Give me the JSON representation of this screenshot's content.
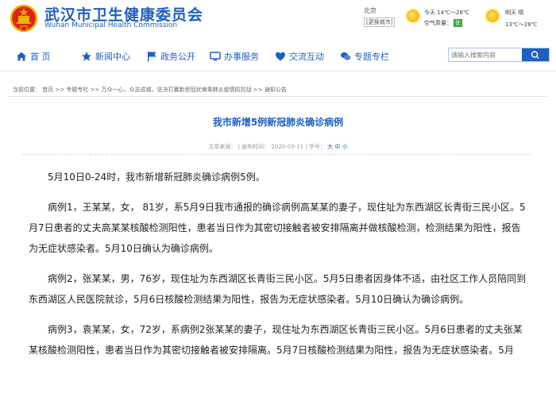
{
  "header": {
    "title_cn": "武汉市卫生健康委员会",
    "title_en": "Wuhan Municipal Health Commission",
    "emblem_icon": "national-emblem-icon",
    "weather": {
      "city": "北京",
      "change_city": "[更换城市]",
      "today": "今天  14℃～28℃",
      "air_label": "空气质量：",
      "air_value": "优",
      "tomorrow": "明天  晴",
      "tomorrow_temp": "13℃～28℃",
      "sun_icon": "sunny-icon"
    }
  },
  "nav": {
    "items": [
      {
        "label": "首 页",
        "icon": "home-icon"
      },
      {
        "label": "新闻中心",
        "icon": "star-icon"
      },
      {
        "label": "政务公开",
        "icon": "flag-icon"
      },
      {
        "label": "办事服务",
        "icon": "monitor-icon"
      },
      {
        "label": "交流互动",
        "icon": "heart-icon"
      },
      {
        "label": "专题专栏",
        "icon": "chat-icon"
      }
    ],
    "search_placeholder": "请输入搜索内容",
    "search_icon": "search-icon"
  },
  "breadcrumb": "当前位置： 首页 >> 专题专栏 >> 万众一心，众志成城，坚决打赢新型冠状病毒肺炎疫情防控战 >> 通知公告",
  "article": {
    "title": "我市新增5例新冠肺炎确诊病例",
    "source_label": "文章来源：",
    "date_label": "| 发布时间：",
    "date": "2020-05-11",
    "font_label": "| 字号：",
    "font_sizes": "大 中 小",
    "paragraphs": [
      "5月10日0-24时，我市新增新冠肺炎确诊病例5例。",
      "病例1，王某某，女， 81岁，系5月9日我市通报的确诊病例高某某的妻子，现住址为东西湖区长青街三民小区。5月7日患者的丈夫高某某核酸检测阳性，患者当日作为其密切接触者被安排隔离并做核酸检测，检测结果为阳性，报告为无症状感染者。5月10日确认为确诊病例。",
      "病例2，张某某，男，76岁，现住址为东西湖区长青街三民小区。5月5日患者因身体不适，由社区工作人员陪同到东西湖区人民医院就诊，5月6日核酸检测结果为阳性，报告为无症状感染者。5月10日确认为确诊病例。",
      "病例3，袁某某，女，72岁，系病例2张某某的妻子，现住址为东西湖区长青街三民小区。5月6日患者的丈夫张某某核酸检测阳性，患者当日作为其密切接触者被安排隔离。5月7日核酸检测结果为阳性，报告为无症状感染者。5月"
    ]
  },
  "colors": {
    "brand_blue": "#1f5fbf",
    "air_good": "#3da33d"
  }
}
